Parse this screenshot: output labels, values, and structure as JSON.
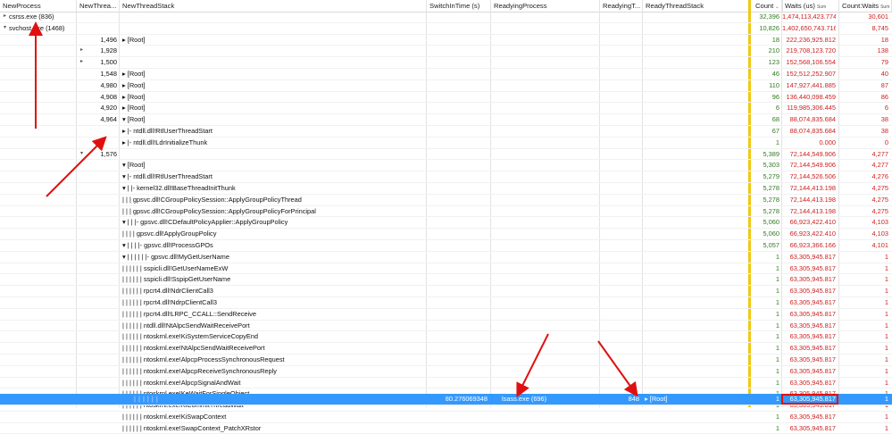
{
  "headers": {
    "new_process": "NewProcess",
    "new_thread": "NewThrea...",
    "new_thread_stack": "NewThreadStack",
    "switch_in_time": "SwitchInTime (s)",
    "readying_process": "ReadyingProcess",
    "readying_thread": "ReadyingT...",
    "ready_thread_stack": "ReadyThreadStack",
    "count": "Count",
    "waits": "Waits (us)",
    "waits_sub": "Sum",
    "count_waits": "Count:Waits",
    "count_waits_sub": "Sum"
  },
  "rows": [
    {
      "process": "csrss.exe (836)",
      "pexp": "▸",
      "thread": "",
      "texp": "",
      "stack": "",
      "count": "32,396",
      "waits": "1,474,113,423.774",
      "cw": "30,601"
    },
    {
      "process": "svchost.exe (1468)",
      "pexp": "▾",
      "thread": "",
      "texp": "",
      "stack": "",
      "count": "10,826",
      "waits": "1,402,650,743.716",
      "cw": "8,745"
    },
    {
      "process": "",
      "thread": "1,496",
      "texp": "",
      "stack": "▸ [Root]",
      "count": "18",
      "waits": "222,236,925.812",
      "cw": "18"
    },
    {
      "process": "",
      "thread": "1,928",
      "texp": "▸",
      "stack": "",
      "count": "210",
      "waits": "219,708,123.720",
      "cw": "138"
    },
    {
      "process": "",
      "thread": "1,500",
      "texp": "▸",
      "stack": "",
      "count": "123",
      "waits": "152,568,106.554",
      "cw": "79"
    },
    {
      "process": "",
      "thread": "1,548",
      "texp": "",
      "stack": "▸ [Root]",
      "count": "46",
      "waits": "152,512,252.907",
      "cw": "40"
    },
    {
      "process": "",
      "thread": "4,980",
      "texp": "",
      "stack": "▸ [Root]",
      "count": "110",
      "waits": "147,927,441.885",
      "cw": "87"
    },
    {
      "process": "",
      "thread": "4,908",
      "texp": "",
      "stack": "▸ [Root]",
      "count": "96",
      "waits": "136,440,098.459",
      "cw": "86"
    },
    {
      "process": "",
      "thread": "4,920",
      "texp": "",
      "stack": "▸ [Root]",
      "count": "6",
      "waits": "119,985,306.445",
      "cw": "6"
    },
    {
      "process": "",
      "thread": "4,964",
      "texp": "",
      "stack": "▾ [Root]",
      "count": "68",
      "waits": "88,074,835.684",
      "cw": "38"
    },
    {
      "process": "",
      "thread": "",
      "texp": "",
      "stack": "▸ |- ntdll.dll!RtlUserThreadStart",
      "count": "67",
      "waits": "88,074,835.684",
      "cw": "38"
    },
    {
      "process": "",
      "thread": "",
      "texp": "",
      "stack": "▸ |- ntdll.dll!LdrInitializeThunk",
      "count": "1",
      "waits": "0.000",
      "cw": "0"
    },
    {
      "process": "",
      "thread": "1,576",
      "texp": "▾",
      "stack": "",
      "count": "5,389",
      "waits": "72,144,549.906",
      "cw": "4,277"
    },
    {
      "process": "",
      "thread": "",
      "texp": "",
      "stack": "▾ [Root]",
      "count": "5,303",
      "waits": "72,144,549.906",
      "cw": "4,277"
    },
    {
      "process": "",
      "thread": "",
      "texp": "",
      "stack": "▾ |- ntdll.dll!RtlUserThreadStart",
      "count": "5,279",
      "waits": "72,144,526.506",
      "cw": "4,276"
    },
    {
      "process": "",
      "thread": "",
      "texp": "",
      "stack": "▾ | |- kernel32.dll!BaseThreadInitThunk",
      "count": "5,278",
      "waits": "72,144,413.198",
      "cw": "4,275"
    },
    {
      "process": "",
      "thread": "",
      "texp": "",
      "stack": "| | |   gpsvc.dll!CGroupPolicySession::ApplyGroupPolicyThread",
      "count": "5,278",
      "waits": "72,144,413.198",
      "cw": "4,275"
    },
    {
      "process": "",
      "thread": "",
      "texp": "",
      "stack": "| | |   gpsvc.dll!CGroupPolicySession::ApplyGroupPolicyForPrincipal",
      "count": "5,278",
      "waits": "72,144,413.198",
      "cw": "4,275"
    },
    {
      "process": "",
      "thread": "",
      "texp": "",
      "stack": "▾ | | |- gpsvc.dll!CDefaultPolicyApplier::ApplyGroupPolicy",
      "count": "5,060",
      "waits": "66,923,422.410",
      "cw": "4,103"
    },
    {
      "process": "",
      "thread": "",
      "texp": "",
      "stack": "| | | |   gpsvc.dll!ApplyGroupPolicy",
      "count": "5,060",
      "waits": "66,923,422.410",
      "cw": "4,103"
    },
    {
      "process": "",
      "thread": "",
      "texp": "",
      "stack": "▾ | | | |- gpsvc.dll!ProcessGPOs",
      "count": "5,057",
      "waits": "66,923,366.166",
      "cw": "4,101"
    },
    {
      "process": "",
      "thread": "",
      "texp": "",
      "stack": "▾ | | | | | |- gpsvc.dll!MyGetUserName",
      "count": "1",
      "waits": "63,305,945.817",
      "cw": "1"
    },
    {
      "process": "",
      "thread": "",
      "texp": "",
      "stack": "| | | | | |   sspicli.dll!GetUserNameExW",
      "count": "1",
      "waits": "63,305,945.817",
      "cw": "1"
    },
    {
      "process": "",
      "thread": "",
      "texp": "",
      "stack": "| | | | | |   sspicli.dll!SspipGetUserName",
      "count": "1",
      "waits": "63,305,945.817",
      "cw": "1"
    },
    {
      "process": "",
      "thread": "",
      "texp": "",
      "stack": "| | | | | |   rpcrt4.dll!NdrClientCall3",
      "count": "1",
      "waits": "63,305,945.817",
      "cw": "1"
    },
    {
      "process": "",
      "thread": "",
      "texp": "",
      "stack": "| | | | | |   rpcrt4.dll!NdrpClientCall3",
      "count": "1",
      "waits": "63,305,945.817",
      "cw": "1"
    },
    {
      "process": "",
      "thread": "",
      "texp": "",
      "stack": "| | | | | |   rpcrt4.dll!LRPC_CCALL::SendReceive",
      "count": "1",
      "waits": "63,305,945.817",
      "cw": "1"
    },
    {
      "process": "",
      "thread": "",
      "texp": "",
      "stack": "| | | | | |   ntdll.dll!NtAlpcSendWaitReceivePort",
      "count": "1",
      "waits": "63,305,945.817",
      "cw": "1"
    },
    {
      "process": "",
      "thread": "",
      "texp": "",
      "stack": "| | | | | |   ntoskrnl.exe!KiSystemServiceCopyEnd",
      "count": "1",
      "waits": "63,305,945.817",
      "cw": "1"
    },
    {
      "process": "",
      "thread": "",
      "texp": "",
      "stack": "| | | | | |   ntoskrnl.exe!NtAlpcSendWaitReceivePort",
      "count": "1",
      "waits": "63,305,945.817",
      "cw": "1"
    },
    {
      "process": "",
      "thread": "",
      "texp": "",
      "stack": "| | | | | |   ntoskrnl.exe!AlpcpProcessSynchronousRequest",
      "count": "1",
      "waits": "63,305,945.817",
      "cw": "1"
    },
    {
      "process": "",
      "thread": "",
      "texp": "",
      "stack": "| | | | | |   ntoskrnl.exe!AlpcpReceiveSynchronousReply",
      "count": "1",
      "waits": "63,305,945.817",
      "cw": "1"
    },
    {
      "process": "",
      "thread": "",
      "texp": "",
      "stack": "| | | | | |   ntoskrnl.exe!AlpcpSignalAndWait",
      "count": "1",
      "waits": "63,305,945.817",
      "cw": "1"
    },
    {
      "process": "",
      "thread": "",
      "texp": "",
      "stack": "| | | | | |   ntoskrnl.exe!KeWaitForSingleObject",
      "count": "1",
      "waits": "63,305,945.817",
      "cw": "1"
    },
    {
      "process": "",
      "thread": "",
      "texp": "",
      "stack": "| | | | | |   ntoskrnl.exe!KiCommitThreadWait",
      "count": "1",
      "waits": "63,305,945.817",
      "cw": "1"
    },
    {
      "process": "",
      "thread": "",
      "texp": "",
      "stack": "| | | | | |   ntoskrnl.exe!KiSwapContext",
      "count": "1",
      "waits": "63,305,945.817",
      "cw": "1"
    },
    {
      "process": "",
      "thread": "",
      "texp": "",
      "stack": "| | | | | |   ntoskrnl.exe!SwapContext_PatchXRstor",
      "count": "1",
      "waits": "63,305,945.817",
      "cw": "1"
    }
  ],
  "selected": {
    "stack": "| | | | | |",
    "switch_in": "80.276069348",
    "readying_process": "lsass.exe (696)",
    "readying_thread": "848",
    "ready_stack": "▸ [Root]",
    "count": "1",
    "waits": "63,305,945.817",
    "cw": "1"
  },
  "colors": {
    "selection": "#3399ff",
    "count_green": "#2e7d1f",
    "waits_red": "#cc1f1f",
    "divider_yellow": "#f2c811",
    "annotation_red": "#e01010"
  }
}
